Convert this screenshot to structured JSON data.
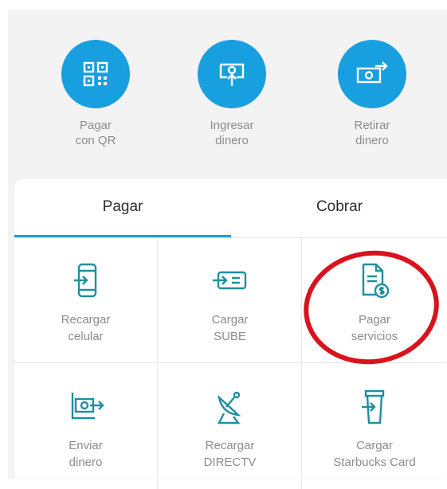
{
  "quick_actions": [
    {
      "label": "Pagar\ncon QR",
      "icon": "qr-code-icon"
    },
    {
      "label": "Ingresar\ndinero",
      "icon": "deposit-money-icon"
    },
    {
      "label": "Retirar\ndinero",
      "icon": "withdraw-money-icon"
    }
  ],
  "tabs": [
    {
      "label": "Pagar",
      "active": true
    },
    {
      "label": "Cobrar",
      "active": false
    }
  ],
  "services": [
    {
      "label": "Recargar\ncelular",
      "icon": "phone-recharge-icon"
    },
    {
      "label": "Cargar\nSUBE",
      "icon": "transport-card-icon"
    },
    {
      "label": "Pagar\nservicios",
      "icon": "bill-payment-icon"
    },
    {
      "label": "Enviar\ndinero",
      "icon": "send-money-icon"
    },
    {
      "label": "Recargar\nDIRECTV",
      "icon": "satellite-dish-icon"
    },
    {
      "label": "Cargar\nStarbucks Card",
      "icon": "coffee-cup-icon"
    }
  ],
  "colors": {
    "accent": "#189fe0",
    "icon_teal": "#1f8fa0",
    "highlight": "#d9131d"
  }
}
